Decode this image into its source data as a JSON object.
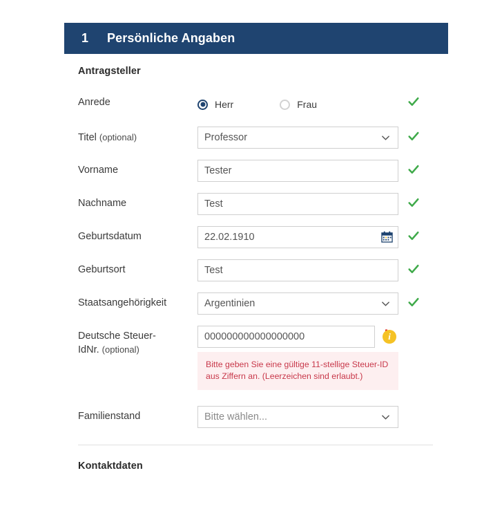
{
  "header": {
    "number": "1",
    "title": "Persönliche Angaben"
  },
  "groups": {
    "applicant_title": "Antragsteller",
    "contact_title": "Kontaktdaten"
  },
  "fields": {
    "anrede": {
      "label": "Anrede",
      "options": [
        {
          "label": "Herr",
          "selected": true
        },
        {
          "label": "Frau",
          "selected": false
        }
      ],
      "status": "valid"
    },
    "titel": {
      "label": "Titel",
      "optional_suffix": "(optional)",
      "value": "Professor",
      "status": "valid"
    },
    "vorname": {
      "label": "Vorname",
      "value": "Tester",
      "status": "valid"
    },
    "nachname": {
      "label": "Nachname",
      "value": "Test",
      "status": "valid"
    },
    "geburtsdatum": {
      "label": "Geburtsdatum",
      "value": "22.02.1910",
      "status": "valid"
    },
    "geburtsort": {
      "label": "Geburtsort",
      "value": "Test",
      "status": "valid"
    },
    "staatsangehoerigkeit": {
      "label": "Staatsangehörigkeit",
      "value": "Argentinien",
      "status": "valid"
    },
    "steuer_id": {
      "label_line1": "Deutsche Steuer-",
      "label_line2": "IdNr.",
      "optional_suffix": "(optional)",
      "value": "000000000000000000",
      "status": "error",
      "error_message": "Bitte geben Sie eine gültige 11-stellige Steuer-ID aus Ziffern an. (Leerzeichen sind erlaubt.)",
      "info_glyph": "i",
      "error_glyph": "!"
    },
    "familienstand": {
      "label": "Familienstand",
      "value": "Bitte wählen...",
      "status": "none"
    }
  },
  "colors": {
    "header_bg": "#1f4470",
    "valid_green": "#3faa4a",
    "error_red": "#e2231a",
    "error_text": "#c8384a",
    "error_bg": "#fdeff0",
    "info_amber": "#f5c225",
    "input_border": "#cfcfcf"
  }
}
